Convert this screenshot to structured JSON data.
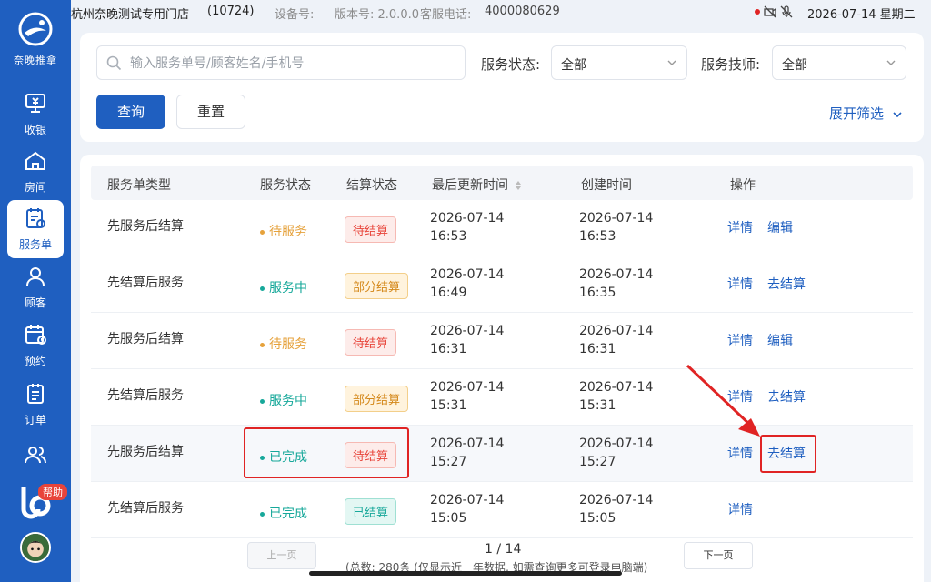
{
  "sidebar": {
    "logo_text": "奈晚推拿",
    "items": [
      {
        "label": "收银",
        "icon": "cashier-icon"
      },
      {
        "label": "房间",
        "icon": "home-icon"
      },
      {
        "label": "服务单",
        "icon": "service-order-icon",
        "active": true
      },
      {
        "label": "顾客",
        "icon": "user-icon"
      },
      {
        "label": "预约",
        "icon": "calendar-icon"
      },
      {
        "label": "订单",
        "icon": "order-icon"
      },
      {
        "label": "",
        "icon": "staff-icon"
      }
    ],
    "help_label": "帮助"
  },
  "topbar": {
    "store_name": "杭州奈晚测试专用门店",
    "store_id": "(10724)",
    "device_label": "设备号:",
    "version": "版本号: 2.0.0.0",
    "service_label": "客服电话:",
    "service_phone": "4000080629",
    "datetime": "2026-07-14 星期二"
  },
  "filters": {
    "search_placeholder": "输入服务单号/顾客姓名/手机号",
    "status_label": "服务状态:",
    "status_value": "全部",
    "tech_label": "服务技师:",
    "tech_value": "全部",
    "query_label": "查询",
    "reset_label": "重置",
    "expand_label": "展开筛选"
  },
  "table": {
    "headers": [
      "服务单类型",
      "服务状态",
      "结算状态",
      "最后更新时间",
      "创建时间",
      "操作"
    ],
    "rows": [
      {
        "type": "先服务后结算",
        "status": "待服务",
        "settle": "待结算",
        "updated_date": "2026-07-14",
        "updated_time": "16:53",
        "created_date": "2026-07-14",
        "created_time": "16:53",
        "op1": "详情",
        "op2": "编辑"
      },
      {
        "type": "先结算后服务",
        "status": "服务中",
        "settle": "部分结算",
        "updated_date": "2026-07-14",
        "updated_time": "16:49",
        "created_date": "2026-07-14",
        "created_time": "16:35",
        "op1": "详情",
        "op2": "去结算"
      },
      {
        "type": "先服务后结算",
        "status": "待服务",
        "settle": "待结算",
        "updated_date": "2026-07-14",
        "updated_time": "16:31",
        "created_date": "2026-07-14",
        "created_time": "16:31",
        "op1": "详情",
        "op2": "编辑"
      },
      {
        "type": "先结算后服务",
        "status": "服务中",
        "settle": "部分结算",
        "updated_date": "2026-07-14",
        "updated_time": "15:31",
        "created_date": "2026-07-14",
        "created_time": "15:31",
        "op1": "详情",
        "op2": "去结算"
      },
      {
        "type": "先服务后结算",
        "status": "已完成",
        "settle": "待结算",
        "updated_date": "2026-07-14",
        "updated_time": "15:27",
        "created_date": "2026-07-14",
        "created_time": "15:27",
        "op1": "详情",
        "op2": "去结算"
      },
      {
        "type": "先结算后服务",
        "status": "已完成",
        "settle": "已结算",
        "updated_date": "2026-07-14",
        "updated_time": "15:05",
        "created_date": "2026-07-14",
        "created_time": "15:05",
        "op1": "详情",
        "op2": ""
      }
    ]
  },
  "pagination": {
    "prev_label": "上一页",
    "next_label": "下一页",
    "current": "1",
    "total": "14",
    "note": "(总数: 280条 (仅显示近一年数据, 如需查询更多可登录电脑端)"
  },
  "colors": {
    "primary": "#1f5fc0",
    "sidebar": "#1f5fc0",
    "waiting": "#e6a23c",
    "in_progress": "#17a89a",
    "annotation": "#e02424"
  }
}
